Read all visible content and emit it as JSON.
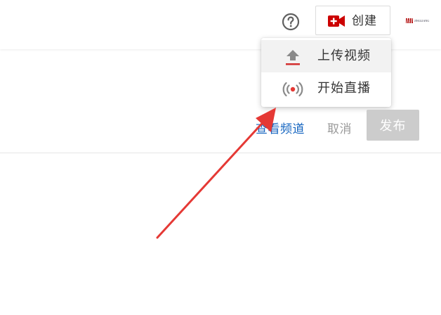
{
  "header": {
    "create_label": "创建",
    "avatar_text": "JINGLIANG"
  },
  "create_menu": {
    "items": [
      {
        "label": "上传视频",
        "icon": "upload-icon"
      },
      {
        "label": "开始直播",
        "icon": "live-broadcast-icon"
      }
    ]
  },
  "actions": {
    "view_channel_label": "查看频道",
    "cancel_label": "取消",
    "publish_label": "发布"
  },
  "colors": {
    "brand_red": "#d32f2f",
    "link_blue": "#1565c0",
    "disabled_gray": "#cccccc",
    "annotation_arrow": "#e53935"
  }
}
